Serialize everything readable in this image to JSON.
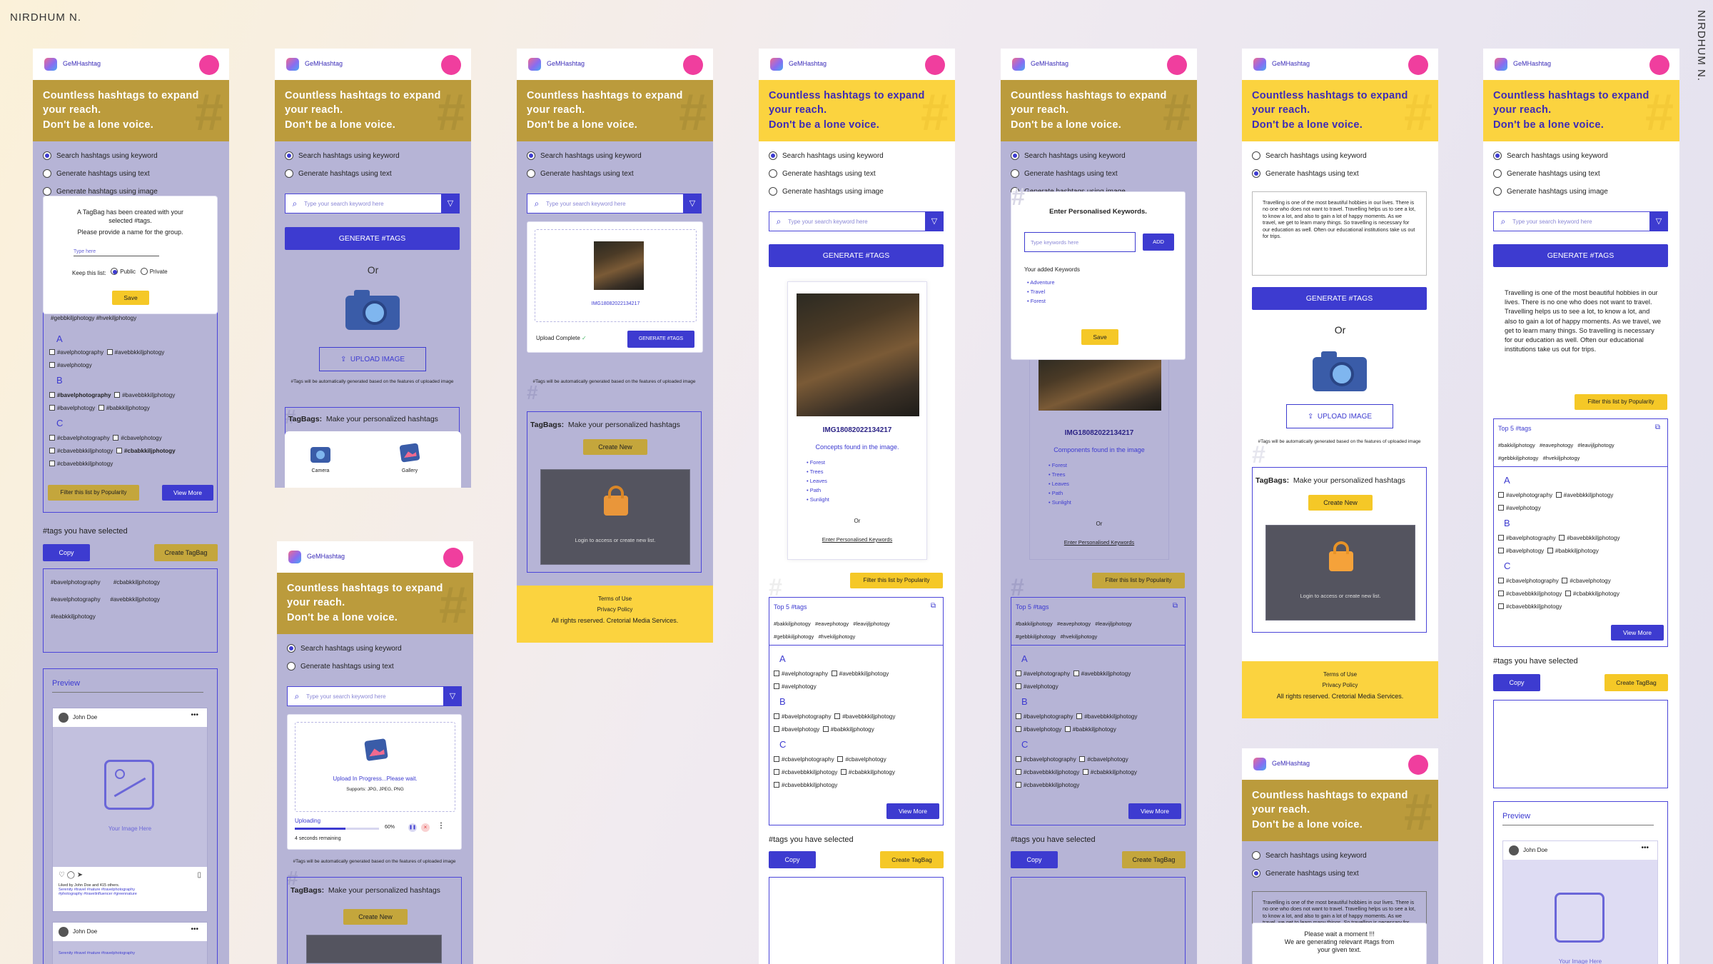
{
  "designer": "NIRDHUM N.",
  "app": {
    "brand": "GeMHashtag",
    "hero_line1": "Countless hashtags to expand",
    "hero_line2": "your reach.",
    "hero_line3": "Don't be a lone voice."
  },
  "modes": [
    "Search hashtags using keyword",
    "Generate hashtags using text",
    "Generate hashtags using image"
  ],
  "search": {
    "placeholder": "Type your search keyword here",
    "generate": "GENERATE #TAGS"
  },
  "or": "Or",
  "upload": {
    "button": "UPLOAD IMAGE",
    "note": "#Tags will be automatically generated based on the features of uploaded image",
    "progress_text": "Upload In Progress...Please wait.",
    "supports": "Supports: JPG, JPEG, PNG",
    "uploading": "Uploading",
    "percent": "60%",
    "progress": 0.6,
    "remaining": "4 seconds remaining",
    "complete": "Upload Complete"
  },
  "image": {
    "name": "IMG18082022134217",
    "concepts_title": "Concepts found in the image.",
    "components_title": "Components found in the image",
    "concepts": [
      "Forest",
      "Trees",
      "Leaves",
      "Path",
      "Sunlight"
    ],
    "or": "Or",
    "enter_link": "Enter Personalised Keywords"
  },
  "tagbags": {
    "title": "TagBags:",
    "subtitle": "Make your personalized hashtags",
    "create": "Create New",
    "login": "Login to access or create new list.",
    "camera": "Camera",
    "gallery": "Gallery"
  },
  "footer": {
    "terms": "Terms of Use",
    "privacy": "Privacy Policy",
    "rights": "All rights reserved. Cretorial Media Services."
  },
  "filter_label": "Filter this list by Popularity",
  "top5": {
    "title": "Top 5 #tags",
    "tags": [
      "#bakkiljphotogy",
      "#eavephotogy",
      "#leavijljphotogy",
      "#gebbkiljphotogy",
      "#hvekiljphotogy"
    ]
  },
  "groups": {
    "A": [
      [
        "#avelphotography",
        "#avebbkkiljphotogy"
      ],
      [
        "#avelphotogy"
      ]
    ],
    "B": [
      [
        "#bavelphotography",
        "#bavebbkkiljphotogy"
      ],
      [
        "#bavelphotogy",
        "#babkkiljphotogy"
      ]
    ],
    "C": [
      [
        "#cbavelphotography",
        "#cbavelphotogy"
      ],
      [
        "#cbavebbkkiljphotogy",
        "#cbabkkiljphotogy"
      ],
      [
        "#cbavebbkkiljphotogy"
      ]
    ]
  },
  "view_more": "View More",
  "selected": {
    "title": "#tags you have selected",
    "copy": "Copy",
    "create": "Create TagBag",
    "tags": [
      "#bavelphotography",
      "#cbabkkiljphotogy",
      "#eavelphotography",
      "#avebbkkiljphotogy",
      "#leabkkiljphotogy"
    ]
  },
  "gebb_row": "#gebbkiljphotogy   #hvekiljphotogy",
  "modal_tagbag": {
    "line1": "A TagBag has been created with your",
    "line2": "selected #tags.",
    "line3": "Please provide a name for the group.",
    "input_placeholder": "Type here",
    "keep": "Keep this list:",
    "public": "Public",
    "private": "Private",
    "save": "Save"
  },
  "modal_keywords": {
    "title": "Enter Personalised Keywords.",
    "placeholder": "Type keywords here",
    "add": "ADD",
    "added_title": "Your added Keywords",
    "added": [
      "Adventure",
      "Travel",
      "Forest"
    ],
    "save": "Save"
  },
  "text_input": "Travelling is one of the most beautiful hobbies in our lives. There is no one who does not want to travel. Travelling helps us to see a lot, to know a lot, and also to gain a lot of happy moments. As we travel, we get to learn many things. So travelling is necessary for our education as well. Often our educational institutions take us out for trips.",
  "highlighted_text": "Travelling is one of the most beautiful hobbies in our lives. There is no one who does not want to travel. Travelling helps us to see a lot, to know a lot, and also to gain a lot of happy moments. As we travel, we get to learn many things. So travelling is necessary for our education as well. Often our educational institutions take us out for trips.",
  "wait": {
    "line1": "Please wait a moment !!!",
    "line2": "We are generating relevant #tags from",
    "line3": "your given text."
  },
  "preview": {
    "title": "Preview",
    "user": "John Doe",
    "image_here": "Your Image Here",
    "liked": "Liked by John Doe and 415 others.",
    "caption1": "Serenity #travel #nature #travelphotography",
    "caption2": "#photography #travelinfluencer #greennature"
  },
  "colors": {
    "primary": "#3d3bd0",
    "yellow": "#fbd33f",
    "pink": "#f03e9e"
  }
}
